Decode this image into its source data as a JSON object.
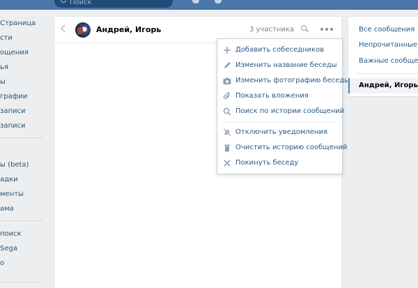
{
  "top": {
    "search_placeholder": "Поиск"
  },
  "left_nav": {
    "items": [
      "Страница",
      "сти",
      "ощения",
      "ья",
      "ы",
      "графии",
      "записи",
      "записи",
      "ы (beta)",
      "адки",
      "менты",
      "ама",
      "поиск",
      "Sega",
      "о"
    ]
  },
  "chat": {
    "title": "Андрей, Игорь",
    "members": "3 участника"
  },
  "menu": {
    "items": [
      {
        "icon": "plus-icon",
        "label": "Добавить собеседников"
      },
      {
        "icon": "pencil-icon",
        "label": "Изменить название беседы"
      },
      {
        "icon": "camera-icon",
        "label": "Изменить фотографию беседы"
      },
      {
        "icon": "paperclip-icon",
        "label": "Показать вложения"
      },
      {
        "icon": "search-icon",
        "label": "Поиск по истории сообщений"
      },
      {
        "icon": "bell-muted-icon",
        "label": "Отключить уведомления"
      },
      {
        "icon": "trash-icon",
        "label": "Очистить историю сообщений"
      },
      {
        "icon": "close-icon",
        "label": "Покинуть беседу"
      }
    ]
  },
  "right": {
    "items": [
      "Все сообщения",
      "Непрочитанные",
      "Важные сообщения"
    ],
    "active": "Андрей, Игорь"
  },
  "colors": {
    "header": "#4a76a8",
    "link": "#2a5885",
    "accent": "#5181b8"
  }
}
